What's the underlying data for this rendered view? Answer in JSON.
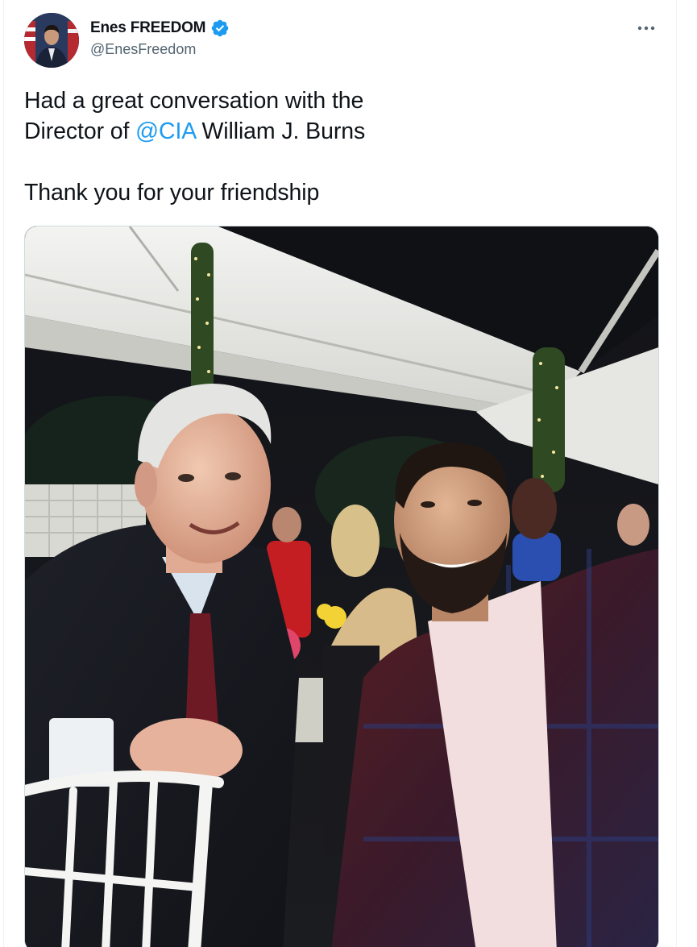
{
  "author": {
    "display_name": "Enes FREEDOM",
    "handle": "@EnesFreedom",
    "verified": true,
    "avatar_icon": "profile-photo"
  },
  "menu": {
    "icon": "more-horizontal-icon"
  },
  "tweet": {
    "line1": "Had a great conversation with the",
    "line2_prefix": "Director of ",
    "mention": "@CIA",
    "line2_suffix": " William J. Burns",
    "line3": "Thank you for your friendship"
  },
  "colors": {
    "accent": "#1d9bf0",
    "text": "#0f1419",
    "secondary": "#536471"
  },
  "media": {
    "type": "photo",
    "description_icon": "photo-two-men-at-outdoor-tent-dinner"
  }
}
